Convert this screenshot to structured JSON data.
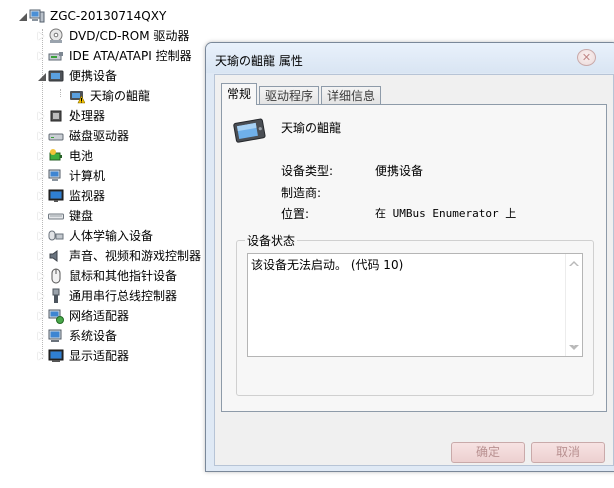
{
  "tree": {
    "root": "ZGC-20130714QXY",
    "items": [
      {
        "label": "DVD/CD-ROM 驱动器",
        "icon": "dvd-drive-icon"
      },
      {
        "label": "IDE ATA/ATAPI 控制器",
        "icon": "ide-controller-icon"
      },
      {
        "label": "便携设备",
        "icon": "portable-device-icon"
      },
      {
        "label": "天瑜の齟龍",
        "icon": "warning-device-icon"
      },
      {
        "label": "处理器",
        "icon": "processor-icon"
      },
      {
        "label": "磁盘驱动器",
        "icon": "disk-drive-icon"
      },
      {
        "label": "电池",
        "icon": "battery-icon"
      },
      {
        "label": "计算机",
        "icon": "computer-icon"
      },
      {
        "label": "监视器",
        "icon": "monitor-icon"
      },
      {
        "label": "键盘",
        "icon": "keyboard-icon"
      },
      {
        "label": "人体学输入设备",
        "icon": "hid-icon"
      },
      {
        "label": "声音、视频和游戏控制器",
        "icon": "sound-icon"
      },
      {
        "label": "鼠标和其他指针设备",
        "icon": "mouse-icon"
      },
      {
        "label": "通用串行总线控制器",
        "icon": "usb-icon"
      },
      {
        "label": "网络适配器",
        "icon": "network-adapter-icon"
      },
      {
        "label": "系统设备",
        "icon": "system-device-icon"
      },
      {
        "label": "显示适配器",
        "icon": "display-adapter-icon"
      }
    ]
  },
  "dialog": {
    "title": "天瑜の齟龍 属性",
    "close_icon": "close-icon",
    "tabs": [
      {
        "label": "常规"
      },
      {
        "label": "驱动程序"
      },
      {
        "label": "详细信息"
      }
    ],
    "device_name": "天瑜の齟龍",
    "properties": [
      {
        "label": "设备类型:",
        "value": "便携设备"
      },
      {
        "label": "制造商:",
        "value": ""
      },
      {
        "label": "位置:",
        "value": "在 UMBus Enumerator 上"
      }
    ],
    "status_group_label": "设备状态",
    "status_text": "该设备无法启动。 (代码 10)",
    "ok_label": "确定",
    "cancel_label": "取消"
  },
  "colors": {
    "dialog_frame": "#dfe9f5",
    "disabled_button": "#ecd0d0",
    "warning": "#f2c200"
  }
}
